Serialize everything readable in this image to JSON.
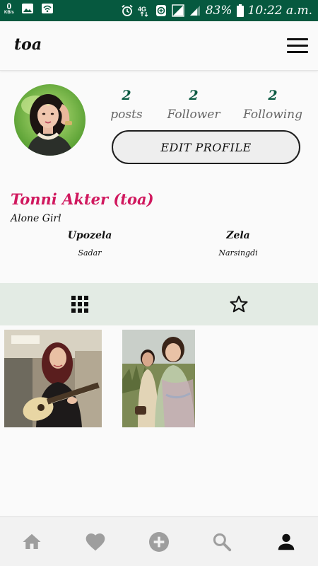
{
  "status_bar": {
    "net_speed_value": "0",
    "net_speed_unit": "KB/s",
    "network_type": "4G",
    "battery": "83%",
    "time": "10:22 a.m.",
    "background": "#06593f",
    "icons": [
      "image-icon",
      "wifi-icon",
      "alarm-icon",
      "data-saver-icon",
      "signal-icon",
      "battery-icon"
    ]
  },
  "app_bar": {
    "title": "toa",
    "menu_icon": "hamburger-menu-icon"
  },
  "profile": {
    "stats": [
      {
        "value": "2",
        "label": "posts"
      },
      {
        "value": "2",
        "label": "Follower"
      },
      {
        "value": "2",
        "label": "Following"
      }
    ],
    "edit_button_label": "EDIT PROFILE",
    "full_name": "Tonni Akter (toa)",
    "bio": "Alone Girl",
    "details": [
      {
        "label": "Upozela",
        "value": "Sadar"
      },
      {
        "label": "Zela",
        "value": "Narsingdi"
      }
    ],
    "name_color": "#d0185e",
    "stat_color": "#0b5a42"
  },
  "tabs": [
    {
      "icon": "grid-icon",
      "active": true
    },
    {
      "icon": "star-icon",
      "active": false
    }
  ],
  "tab_bar_color": "#e3ebe4",
  "posts_count_shown": 2,
  "bottom_nav": [
    {
      "icon": "home-icon",
      "active": false
    },
    {
      "icon": "heart-icon",
      "active": false
    },
    {
      "icon": "add-circle-icon",
      "active": false
    },
    {
      "icon": "search-icon",
      "active": false
    },
    {
      "icon": "profile-icon",
      "active": true
    }
  ]
}
